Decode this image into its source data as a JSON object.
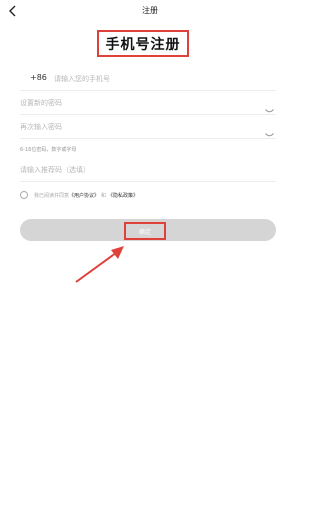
{
  "nav": {
    "back_icon": "chevron-left-icon",
    "title": "注册"
  },
  "heading": "手机号注册",
  "phone": {
    "country_code": "+86",
    "placeholder": "请输入您的手机号"
  },
  "password": {
    "placeholder": "设置新的密码",
    "toggle_icon": "eye-closed-icon"
  },
  "password_confirm": {
    "placeholder": "再次输入密码",
    "toggle_icon": "eye-closed-icon"
  },
  "password_hint": "6-16位密码，数字或字母",
  "referral": {
    "placeholder": "请输入推荐码（选填）"
  },
  "agreement": {
    "prefix": "我已阅读并同意",
    "user_agreement": "《用户协议》",
    "and": "和",
    "privacy_policy": "《隐私政策》",
    "checked": false
  },
  "submit_label": "确定",
  "colors": {
    "highlight": "#e0403a",
    "button_disabled": "#d5d5d5"
  }
}
